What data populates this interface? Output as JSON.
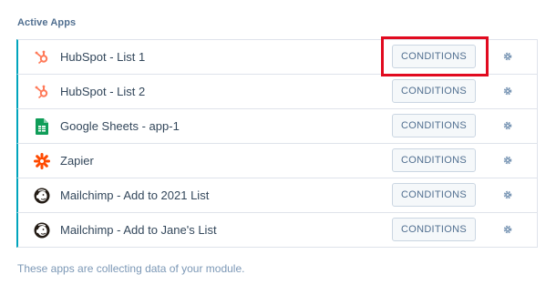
{
  "section_title": "Active Apps",
  "apps": [
    {
      "name": "HubSpot - List 1",
      "icon": "hubspot-icon",
      "button": "CONDITIONS"
    },
    {
      "name": "HubSpot - List 2",
      "icon": "hubspot-icon",
      "button": "CONDITIONS"
    },
    {
      "name": "Google Sheets - app-1",
      "icon": "google-sheets-icon",
      "button": "CONDITIONS"
    },
    {
      "name": "Zapier",
      "icon": "zapier-icon",
      "button": "CONDITIONS"
    },
    {
      "name": "Mailchimp - Add to 2021 List",
      "icon": "mailchimp-icon",
      "button": "CONDITIONS"
    },
    {
      "name": "Mailchimp - Add to Jane's List",
      "icon": "mailchimp-icon",
      "button": "CONDITIONS"
    }
  ],
  "footer_note": "These apps are collecting data of your module.",
  "colors": {
    "accent_border": "#00a4bd",
    "highlight": "#e10a1f",
    "hubspot": "#ff7a59",
    "sheets": "#0f9d58",
    "zapier": "#ff4a00"
  }
}
